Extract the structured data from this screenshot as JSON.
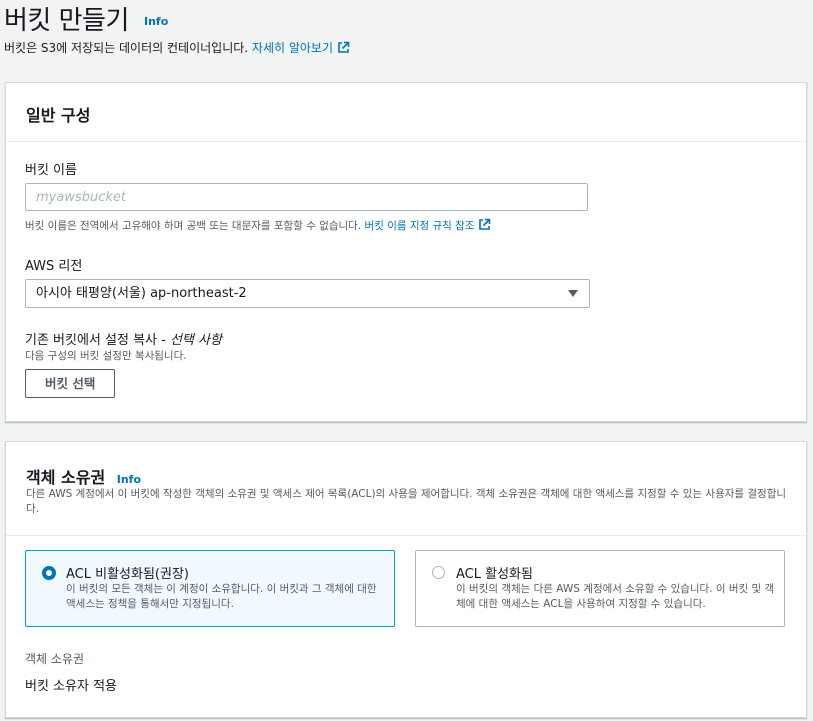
{
  "page": {
    "title": "버킷 만들기",
    "info": "Info",
    "description": "버킷은 S3에 저장되는 데이터의 컨테이너입니다.",
    "learn_more": "자세히 알아보기"
  },
  "general": {
    "title": "일반 구성",
    "bucket_name": {
      "label": "버킷 이름",
      "placeholder": "myawsbucket",
      "value": "",
      "hint": "버킷 이름은 전역에서 고유해야 하며 공백 또는 대문자를 포함할 수 없습니다.",
      "hint_link": "버킷 이름 지정 규칙 참조"
    },
    "region": {
      "label": "AWS 리전",
      "value": "아시아 태평양(서울) ap-northeast-2"
    },
    "copy_settings": {
      "label": "기존 버킷에서 설정 복사 - ",
      "label_optional": "선택 사항",
      "hint": "다음 구성의 버킷 설정만 복사됩니다.",
      "button": "버킷 선택"
    }
  },
  "ownership": {
    "title": "객체 소유권",
    "info": "Info",
    "description": "다른 AWS 계정에서 이 버킷에 작성한 객체의 소유권 및 액세스 제어 목록(ACL)의 사용을 제어합니다. 객체 소유권은 객체에 대한 액세스를 지정할 수 있는 사용자를 결정합니다.",
    "options": [
      {
        "title": "ACL 비활성화됨(권장)",
        "desc": "이 버킷의 모든 객체는 이 계정이 소유합니다. 이 버킷과 그 객체에 대한 액세스는 정책을 통해서만 지정됩니다.",
        "selected": true
      },
      {
        "title": "ACL 활성화됨",
        "desc": "이 버킷의 객체는 다른 AWS 계정에서 소유할 수 있습니다. 이 버킷 및 객체에 대한 액세스는 ACL을 사용하여 지정할 수 있습니다.",
        "selected": false
      }
    ],
    "field_label": "객체 소유권",
    "field_value": "버킷 소유자 적용"
  },
  "colors": {
    "accent": "#0073bb",
    "selected_border": "#00a1c9",
    "selected_bg": "#f1faff"
  }
}
